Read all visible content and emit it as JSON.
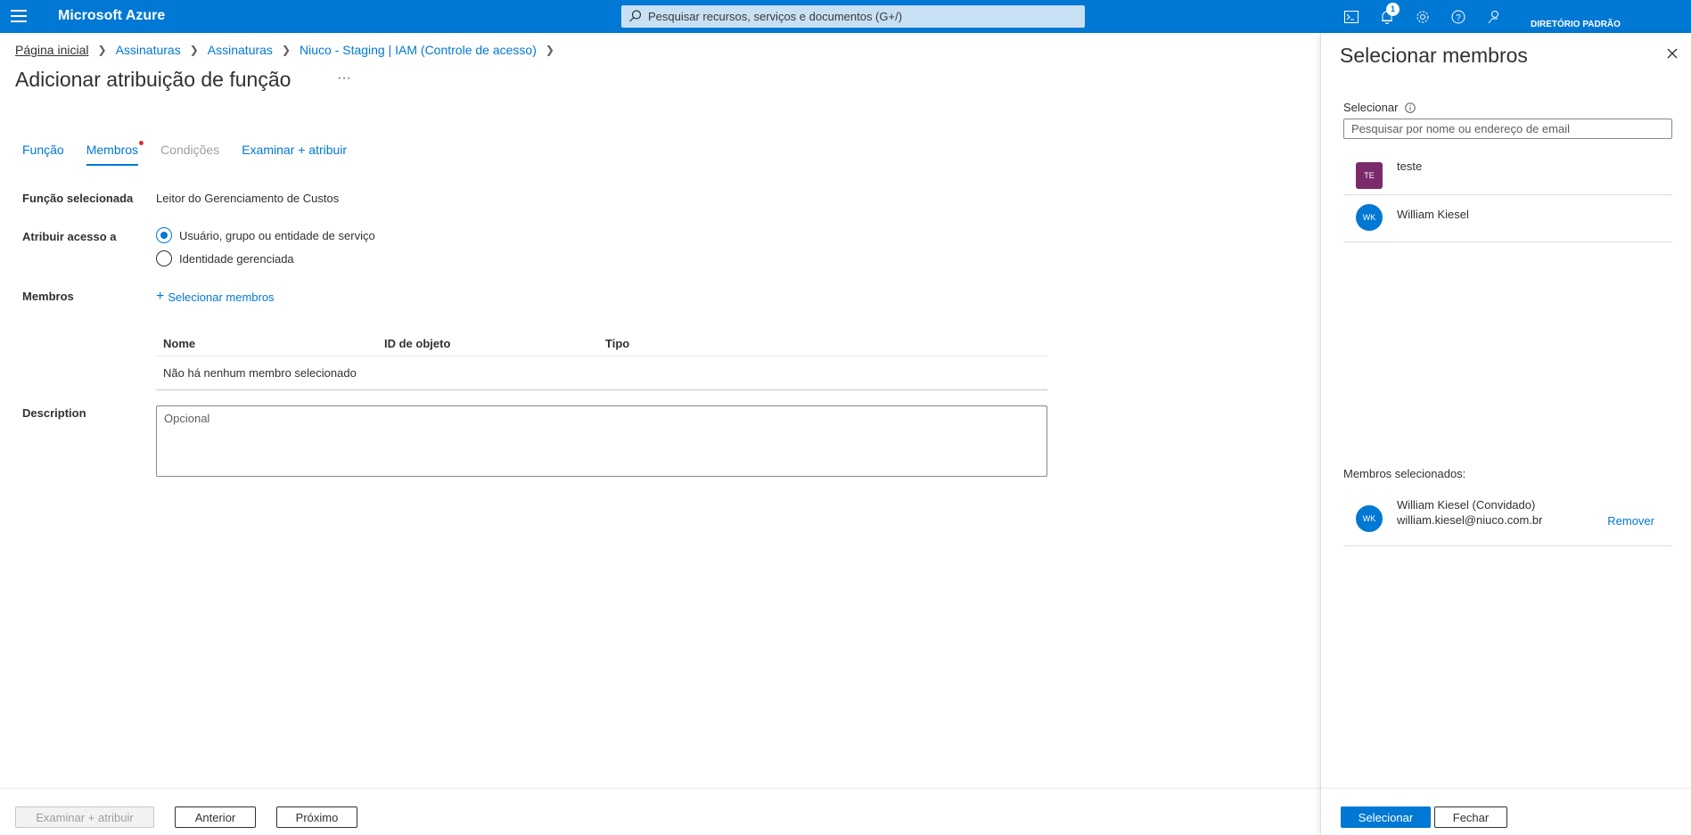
{
  "topbar": {
    "brand": "Microsoft Azure",
    "search_placeholder": "Pesquisar recursos, serviços e documentos (G+/)",
    "notification_count": "1",
    "directory": "DIRETÓRIO PADRÃO",
    "icons": [
      "hamburger-icon",
      "search-icon",
      "cloud-shell-icon",
      "notifications-icon",
      "settings-icon",
      "help-icon",
      "feedback-icon"
    ]
  },
  "breadcrumb": [
    "Página inicial",
    "Assinaturas",
    "Assinaturas",
    "Niuco - Staging | IAM (Controle de acesso)"
  ],
  "page": {
    "title": "Adicionar atribuição de função",
    "more": "···"
  },
  "tabs": [
    {
      "label": "Função"
    },
    {
      "label": "Membros"
    },
    {
      "label": "Condições"
    },
    {
      "label": "Examinar + atribuir"
    }
  ],
  "form": {
    "selected_role_label": "Função selecionada",
    "selected_role_value": "Leitor do Gerenciamento de Custos",
    "assign_access_label": "Atribuir acesso a",
    "option_user": "Usuário, grupo ou entidade de serviço",
    "option_managed": "Identidade gerenciada",
    "members_label": "Membros",
    "select_members_link": "Selecionar membros",
    "table_headers": [
      "Nome",
      "ID de objeto",
      "Tipo"
    ],
    "empty_row": "Não há nenhum membro selecionado",
    "description_label": "Description",
    "description_placeholder": "Opcional"
  },
  "footer": {
    "review_button": "Examinar + atribuir",
    "previous_button": "Anterior",
    "next_button": "Próximo"
  },
  "panel": {
    "title": "Selecionar membros",
    "select_label": "Selecionar",
    "search_placeholder": "Pesquisar por nome ou endereço de email",
    "results": [
      {
        "initials": "TE",
        "name": "teste"
      },
      {
        "initials": "WK",
        "name": "William Kiesel"
      }
    ],
    "selected_label": "Membros selecionados:",
    "selected": {
      "initials": "WK",
      "name": "William Kiesel (Convidado)",
      "email": "william.kiesel@niuco.com.br",
      "remove": "Remover"
    },
    "select_button": "Selecionar",
    "close_button": "Fechar"
  },
  "colors": {
    "accent": "#0078d4",
    "group_avatar": "#7a2a6b",
    "required_dot": "#d13438"
  }
}
